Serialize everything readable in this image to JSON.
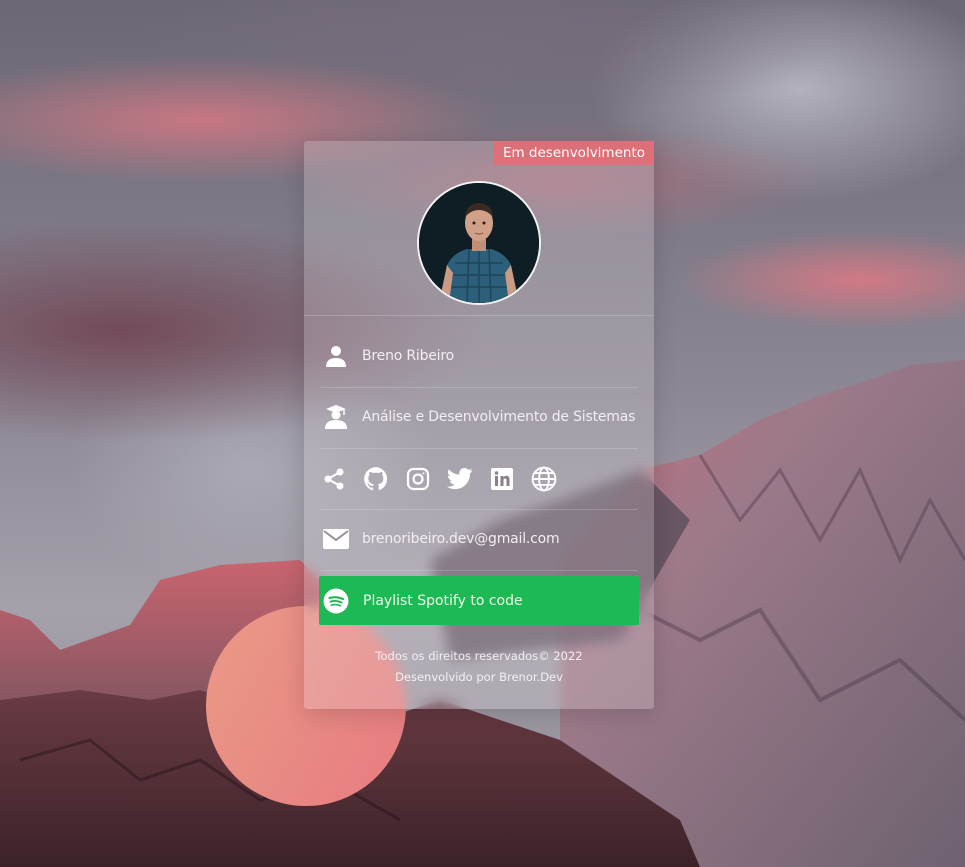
{
  "badge": "Em desenvolvimento",
  "profile": {
    "name": "Breno Ribeiro",
    "course": "Análise e Desenvolvimento de Sistemas",
    "email": "brenoribeiro.dev@gmail.com",
    "avatar_icon": "avatar-3d-man"
  },
  "socials": [
    {
      "name": "share",
      "icon": "share-icon"
    },
    {
      "name": "github",
      "icon": "github-icon"
    },
    {
      "name": "instagram",
      "icon": "instagram-icon"
    },
    {
      "name": "twitter",
      "icon": "twitter-icon"
    },
    {
      "name": "linkedin",
      "icon": "linkedin-icon"
    },
    {
      "name": "website",
      "icon": "globe-icon"
    }
  ],
  "spotify": {
    "label": "Playlist Spotify to code",
    "icon": "spotify-icon",
    "color": "#1db954"
  },
  "footer": {
    "copyright": "Todos os direitos reservados© 2022",
    "developed_by": "Desenvolvido por Brenor.Dev"
  },
  "colors": {
    "badge": "#e26e76",
    "blob": "#e77b80",
    "spotify": "#1db954"
  }
}
